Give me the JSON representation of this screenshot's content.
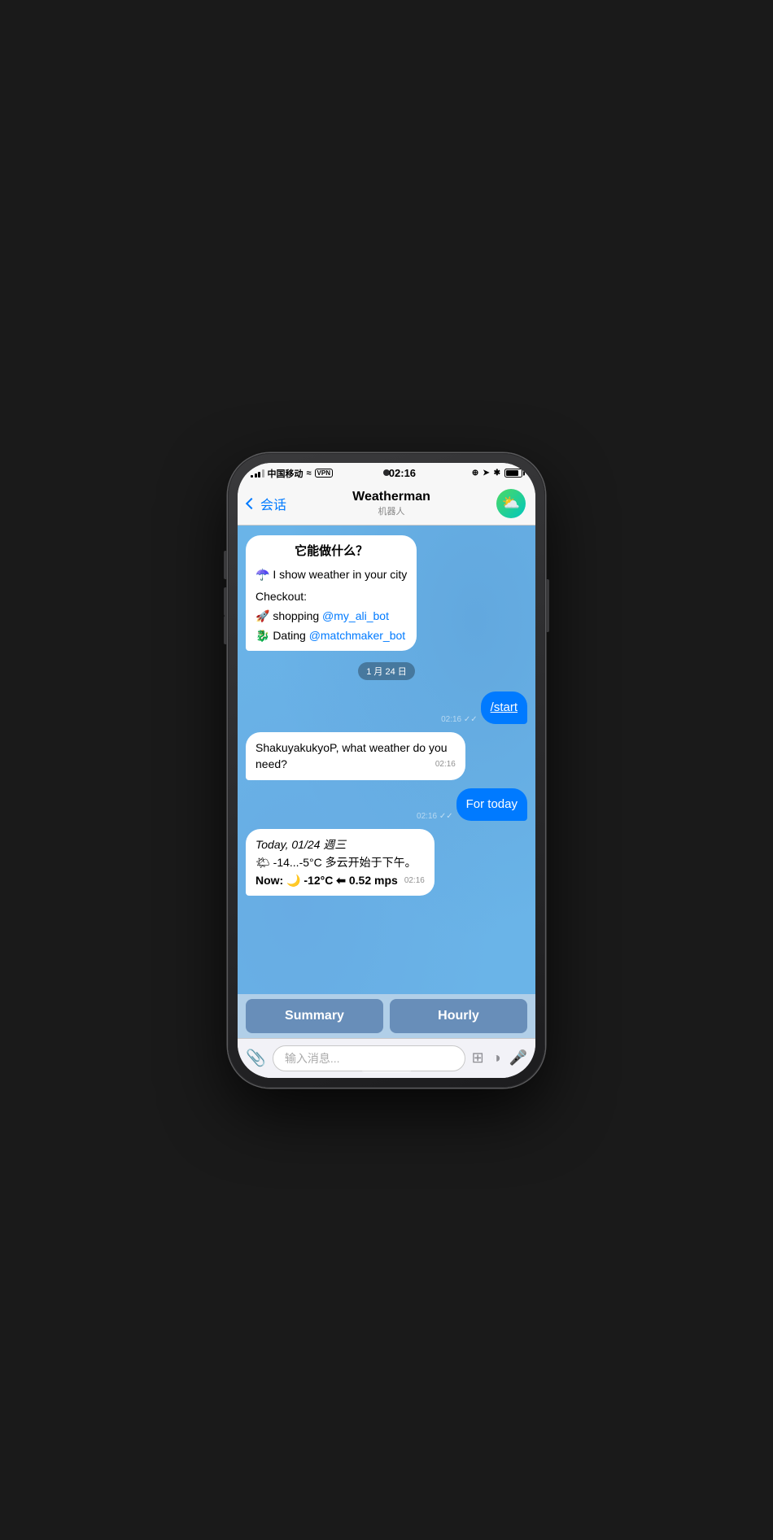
{
  "status_bar": {
    "carrier": "中国移动",
    "wifi": "📶",
    "vpn": "VPN",
    "time": "02:16",
    "battery_level": "85"
  },
  "nav": {
    "back_label": "会话",
    "title": "Weatherman",
    "subtitle": "机器人"
  },
  "chat": {
    "date_separator": "1 月 24 日",
    "messages": [
      {
        "id": "msg1",
        "type": "incoming",
        "content_type": "intro",
        "title": "它能做什么？",
        "line1": "☂️ I show weather in your city",
        "line2_label": "Checkout:",
        "line3": "🚀 shopping ",
        "link3": "@my_ali_bot",
        "line4": "🐉 Dating ",
        "link4": "@matchmaker_bot",
        "time": ""
      },
      {
        "id": "msg2",
        "type": "outgoing",
        "text": "/start",
        "time": "02:16",
        "ticks": "✓✓"
      },
      {
        "id": "msg3",
        "type": "incoming",
        "text": "ShakuyakukyoP, what weather do you need?",
        "time": "02:16"
      },
      {
        "id": "msg4",
        "type": "outgoing",
        "text": "For today",
        "time": "02:16",
        "ticks": "✓✓"
      },
      {
        "id": "msg5",
        "type": "incoming",
        "weather": true,
        "date_line": "Today, 01/24 週三",
        "forecast_line": "🌤 -14...-5°C 多云开始于下午。",
        "now_line": "Now: 🌙 -12°C ⬅ 0.52 mps",
        "time": "02:16"
      }
    ],
    "quick_replies": [
      {
        "id": "qr1",
        "label": "Summary"
      },
      {
        "id": "qr2",
        "label": "Hourly"
      }
    ]
  },
  "input_bar": {
    "placeholder": "输入消息..."
  },
  "icons": {
    "attach": "📎",
    "sticker": "⊞",
    "emoji_face": "◑",
    "mic": "🎤"
  }
}
